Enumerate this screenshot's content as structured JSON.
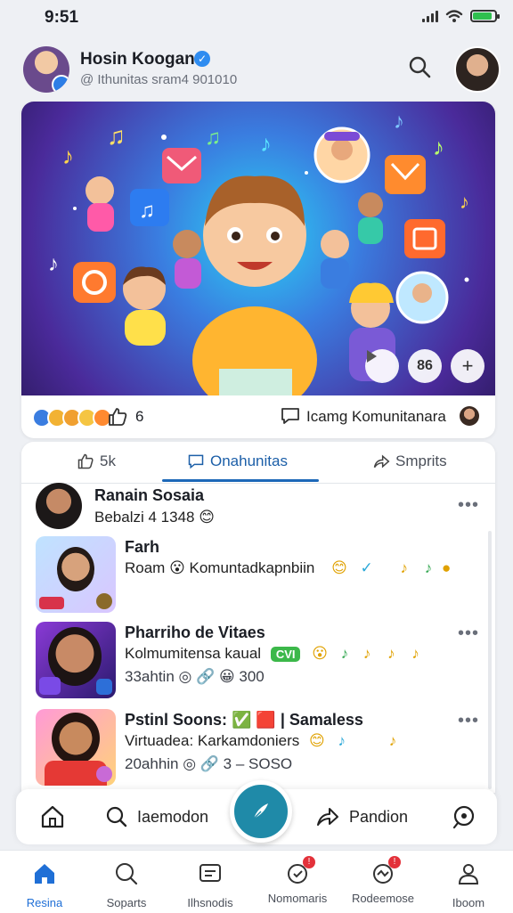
{
  "status_bar": {
    "time": "9:51"
  },
  "header": {
    "name": "Hosin Koogan",
    "handle": "@ Ithunitas  sram4 901010"
  },
  "hero": {
    "count_label": "86",
    "reactions": {
      "like_count": "6",
      "comment_label": "Icamg Komunitanara"
    }
  },
  "tabs": [
    {
      "label": "5k"
    },
    {
      "label": "Onahunitas"
    },
    {
      "label": "Smprits"
    }
  ],
  "feed": [
    {
      "title": "Ranain Sosaia",
      "line1": "Bebalzi 4 1348 😊"
    },
    {
      "title": "Farh",
      "line1": "Roam 😮 Komuntadkapnbiin"
    },
    {
      "title": "Pharriho de Vitaes",
      "line1": "Kolmumitensa kaual",
      "chip": "CVI",
      "meta": "33ahtin ◎ 🔗 😀 300"
    },
    {
      "title": "Pstinl Soons: ✅ 🟥 | Samaless",
      "line1": "Virtuadea: Karkamdoniers",
      "meta": "20ahhin ◎ 🔗 3 – SOSO"
    }
  ],
  "actions": {
    "search_label": "Iaemodon",
    "share_label": "Pandion"
  },
  "bottom_nav": [
    {
      "label": "Resina"
    },
    {
      "label": "Soparts"
    },
    {
      "label": "Ilhsnodis"
    },
    {
      "label": "Nomomaris"
    },
    {
      "label": "Rodeemose"
    },
    {
      "label": "Iboom"
    }
  ],
  "colors": {
    "accent": "#1f6fd6",
    "compose": "#1f8aa8",
    "badge": "#e3313a",
    "hero_center": "#2ad2f4",
    "hero_edge": "#341e6e"
  }
}
